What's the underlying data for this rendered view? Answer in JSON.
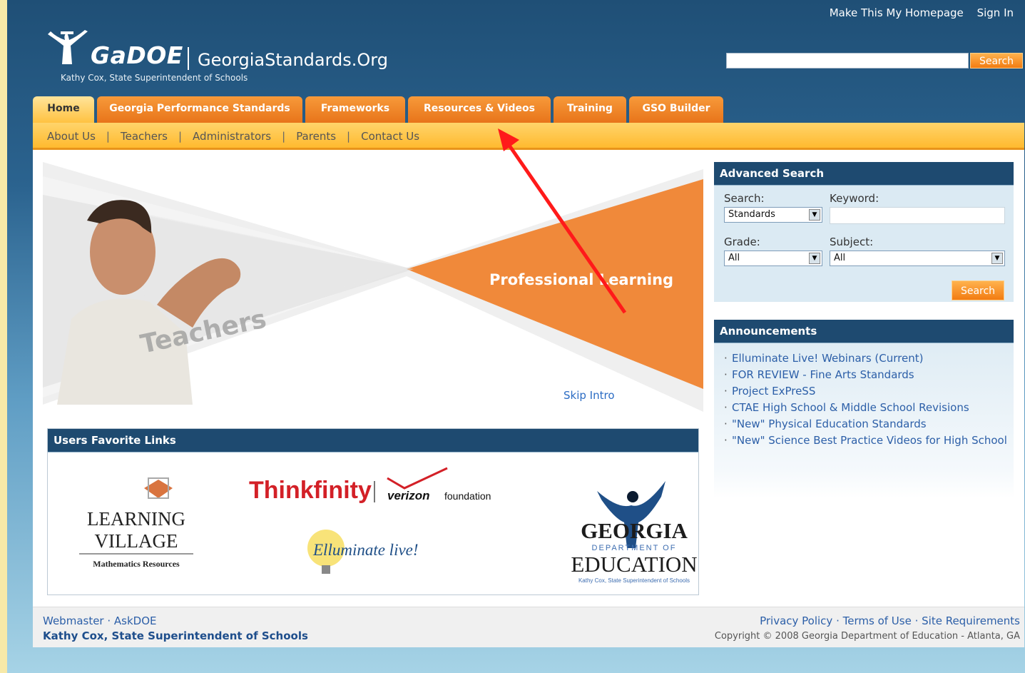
{
  "header": {
    "top_links": [
      "Make This My Homepage",
      "Sign In"
    ],
    "logo_text": "GaDOE",
    "site_name": "GeorgiaStandards.Org",
    "superintendent": "Kathy Cox, State Superintendent of Schools",
    "search_button": "Search"
  },
  "tabs": [
    "Home",
    "Georgia Performance Standards",
    "Frameworks",
    "Resources & Videos",
    "Training",
    "GSO Builder"
  ],
  "subnav": [
    "About Us",
    "Teachers",
    "Administrators",
    "Parents",
    "Contact Us"
  ],
  "hero": {
    "word_left": "Teachers",
    "word_right": "Professional Learning",
    "skip_label": "Skip Intro"
  },
  "favorites": {
    "title": "Users Favorite Links",
    "learning_village": [
      "LEARNING",
      "VILLAGE",
      "Mathematics Resources"
    ],
    "thinkfinity": [
      "Thinkfinity",
      "verizon",
      "foundation"
    ],
    "elluminate": "Elluminate live!",
    "georgia": [
      "GEORGIA",
      "DEPARTMENT OF",
      "EDUCATION",
      "Kathy Cox, State Superintendent of Schools"
    ]
  },
  "advanced_search": {
    "title": "Advanced Search",
    "search_label": "Search:",
    "search_value": "Standards",
    "keyword_label": "Keyword:",
    "grade_label": "Grade:",
    "grade_value": "All",
    "subject_label": "Subject:",
    "subject_value": "All",
    "button": "Search"
  },
  "announcements": {
    "title": "Announcements",
    "items": [
      "Elluminate Live! Webinars (Current)",
      "FOR REVIEW - Fine Arts Standards",
      "Project ExPreSS",
      "CTAE High School & Middle School Revisions",
      "\"New\" Physical Education Standards",
      "\"New\" Science Best Practice Videos for High School"
    ]
  },
  "footer": {
    "webmaster": "Webmaster",
    "askdoe": "AskDOE",
    "superintendent": "Kathy Cox, State Superintendent of Schools",
    "privacy": "Privacy Policy",
    "terms": "Terms of Use",
    "requirements": "Site Requirements",
    "copyright": "Copyright © 2008 Georgia Department of Education - Atlanta, GA"
  },
  "colors": {
    "header_blue": "#1f4f76",
    "tab_orange": "#f0821e",
    "subnav_yellow": "#ffc241",
    "annotation_arrow": "#ff1a1a"
  }
}
